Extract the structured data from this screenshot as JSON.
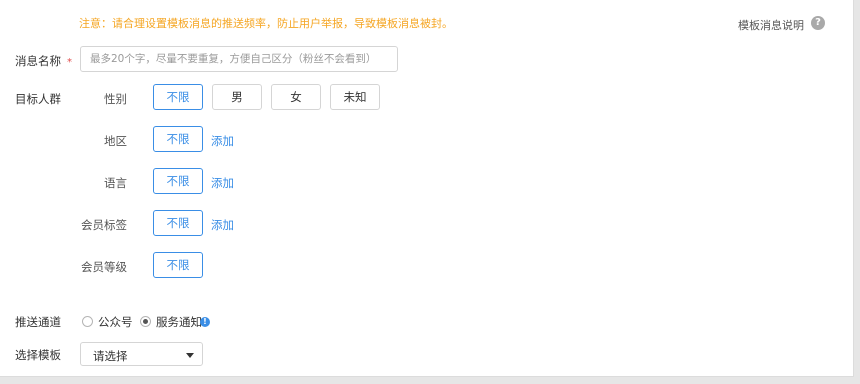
{
  "notice": "注意：请合理设置模板消息的推送频率，防止用户举报，导致模板消息被封。",
  "help": {
    "label": "模板消息说明",
    "icon": "question-circle-icon",
    "icon_glyph": "?"
  },
  "message_name": {
    "label": "消息名称",
    "required_mark": "*",
    "placeholder": "最多20个字，尽量不要重复，方便自己区分（粉丝不会看到）",
    "value": ""
  },
  "target": {
    "label": "目标人群",
    "gender": {
      "label": "性别",
      "options": [
        "不限",
        "男",
        "女",
        "未知"
      ],
      "selected": "不限"
    },
    "region": {
      "label": "地区",
      "options": [
        "不限"
      ],
      "selected": "不限",
      "add_label": "添加"
    },
    "language": {
      "label": "语言",
      "options": [
        "不限"
      ],
      "selected": "不限",
      "add_label": "添加"
    },
    "member_tag": {
      "label": "会员标签",
      "options": [
        "不限"
      ],
      "selected": "不限",
      "add_label": "添加"
    },
    "member_level": {
      "label": "会员等级",
      "options": [
        "不限"
      ],
      "selected": "不限"
    }
  },
  "channel": {
    "label": "推送通道",
    "options": [
      "公众号",
      "服务通知"
    ],
    "selected": "服务通知",
    "info_icon": "info-circle-icon",
    "info_glyph": "!"
  },
  "template": {
    "label": "选择模板",
    "value": "请选择",
    "arrow_icon": "caret-down-icon"
  },
  "colors": {
    "accent": "#3a8ee6",
    "notice": "#f5a623",
    "required": "#e04c4c"
  }
}
